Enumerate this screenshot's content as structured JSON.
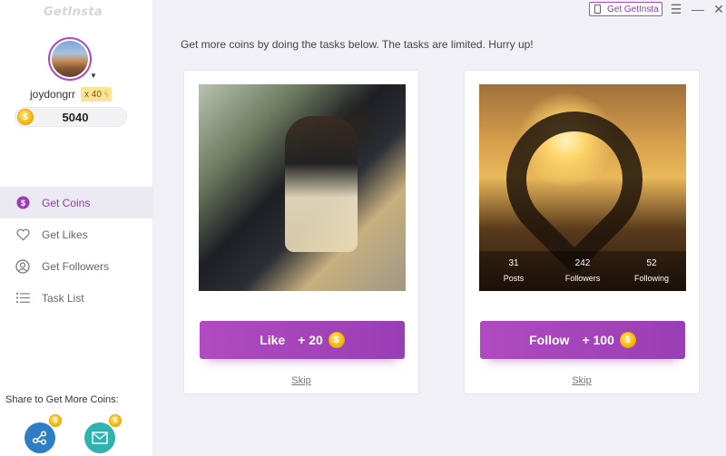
{
  "app": {
    "title": "GetInsta"
  },
  "header": {
    "get_button_label": "Get GetInsta",
    "menu_icon": "hamburger-icon",
    "minimize_icon": "minimize-icon",
    "close_icon": "close-icon"
  },
  "profile": {
    "username": "joydongrr",
    "multiplier": "x 40",
    "coins": "5040"
  },
  "sidebar": {
    "items": [
      {
        "label": "Get Coins",
        "icon": "dollar-coin-icon",
        "active": true
      },
      {
        "label": "Get Likes",
        "icon": "heart-icon",
        "active": false
      },
      {
        "label": "Get Followers",
        "icon": "user-circle-icon",
        "active": false
      },
      {
        "label": "Task List",
        "icon": "list-icon",
        "active": false
      }
    ],
    "share_label": "Share to Get More Coins:"
  },
  "main": {
    "instructions": "Get more coins by doing the tasks below. The tasks are limited. Hurry up!",
    "cards": [
      {
        "verb": "Like",
        "reward": "+ 20",
        "skip": "Skip"
      },
      {
        "verb": "Follow",
        "reward": "+ 100",
        "skip": "Skip",
        "stats": [
          {
            "value": "31",
            "label": "Posts"
          },
          {
            "value": "242",
            "label": "Followers"
          },
          {
            "value": "52",
            "label": "Following"
          }
        ]
      }
    ]
  },
  "colors": {
    "accent": "#b04ac0",
    "coin": "#f5b400",
    "share_network": "#2e7ec6",
    "share_mail": "#2fb3b0"
  }
}
